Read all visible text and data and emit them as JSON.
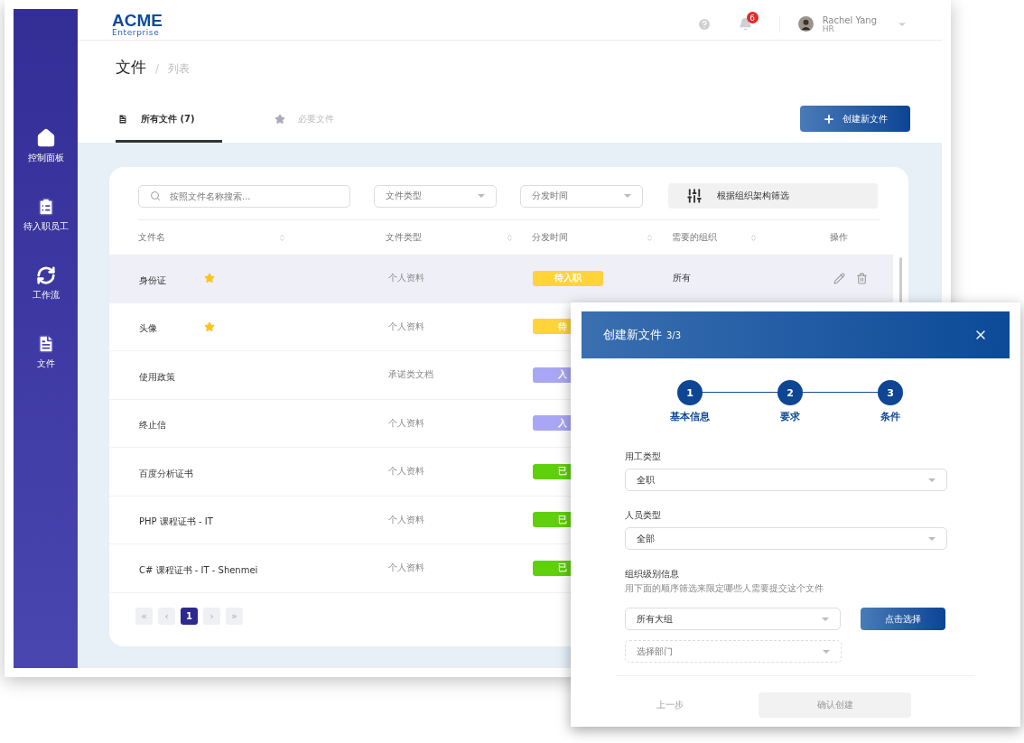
{
  "sidebar": {
    "items": [
      {
        "label": "控制面板",
        "kind": "home"
      },
      {
        "label": "待入职员工",
        "kind": "clipboard"
      },
      {
        "label": "工作流",
        "kind": "cycle"
      },
      {
        "label": "文件",
        "kind": "document"
      }
    ]
  },
  "header": {
    "logo": {
      "name": "ACME",
      "tagline": "Enterprise"
    },
    "notification_count": "6",
    "user": {
      "name": "Rachel Yang",
      "role": "HR"
    }
  },
  "breadcrumb": {
    "items": [
      "文件",
      "列表"
    ],
    "separator": "/"
  },
  "tabs": [
    {
      "label": "所有文件 (7)",
      "kind": "document",
      "selected": true
    },
    {
      "label": "必要文件",
      "kind": "star",
      "selected": false
    }
  ],
  "create_button": "创建新文件",
  "filters": {
    "search": {
      "placeholder": "按照文件名称搜索..."
    },
    "dropdowns": [
      {
        "placeholder": "文件类型"
      },
      {
        "placeholder": "分发时间"
      }
    ],
    "org_filter_button": "根据组织架构筛选"
  },
  "table": {
    "columns": [
      {
        "label": "文件名",
        "sortable": true
      },
      {
        "label": "文件类型",
        "sortable": true
      },
      {
        "label": "分发时间",
        "sortable": true
      },
      {
        "label": "需要的组织",
        "sortable": true
      },
      {
        "label": "操作",
        "sortable": false
      }
    ],
    "rows": [
      {
        "name": "身份证",
        "starred": true,
        "type": "个人资料",
        "status": "待入职",
        "color": "#ffd43b",
        "org": "所有",
        "selected": true
      },
      {
        "name": "头像",
        "starred": true,
        "type": "个人资料",
        "status": "待",
        "color": "#ffd43b",
        "selected": false
      },
      {
        "name": "使用政策",
        "starred": false,
        "type": "承诺类文档",
        "status": "入",
        "color": "#a9a7f5",
        "selected": false
      },
      {
        "name": "终止信",
        "starred": false,
        "type": "个人资料",
        "status": "入",
        "color": "#a9a7f5",
        "selected": false
      },
      {
        "name": "百度分析证书",
        "starred": false,
        "type": "个人资料",
        "status": "已",
        "color": "#5fd00c",
        "selected": false
      },
      {
        "name": "PHP 课程证书 - IT",
        "starred": false,
        "type": "个人资料",
        "status": "已",
        "color": "#5fd00c",
        "selected": false
      },
      {
        "name": "C# 课程证书 - IT - Shenmei",
        "starred": false,
        "type": "个人资料",
        "status": "已",
        "color": "#5fd00c",
        "selected": false
      }
    ]
  },
  "pagination": [
    {
      "label": "«",
      "selected": false
    },
    {
      "label": "‹",
      "selected": false
    },
    {
      "label": "1",
      "selected": true
    },
    {
      "label": "›",
      "selected": false
    },
    {
      "label": "»",
      "selected": false
    }
  ],
  "dialog": {
    "title": "创建新文件",
    "step_count": "3/3",
    "steps": [
      {
        "number": "1",
        "label": "基本信息",
        "done": true
      },
      {
        "number": "2",
        "label": "要求",
        "done": true
      },
      {
        "number": "3",
        "label": "条件",
        "done": true
      }
    ],
    "fields": [
      {
        "label": "用工类型",
        "value": "全职"
      },
      {
        "label": "人员类型",
        "value": "全部"
      }
    ],
    "org_section": {
      "label": "组织级别信息",
      "hint": "用下面的顺序筛选来限定哪些人需要提交这个文件",
      "group_select": {
        "value": "所有大组"
      },
      "choose_button": "点击选择",
      "department_select": {
        "placeholder": "选择部门",
        "disabled": true
      }
    },
    "back_button": {
      "label": "上一步",
      "disabled": true
    },
    "confirm_button": {
      "label": "确认创建",
      "disabled": true
    }
  }
}
